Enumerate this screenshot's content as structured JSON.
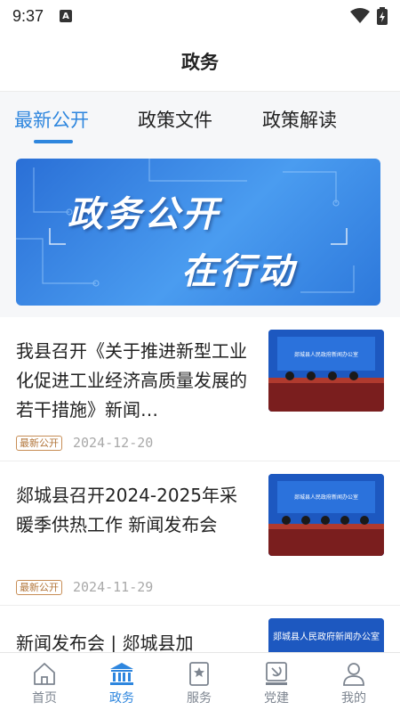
{
  "status": {
    "time": "9:37"
  },
  "header": {
    "title": "政务"
  },
  "tabs": [
    {
      "label": "最新公开",
      "active": true
    },
    {
      "label": "政策文件",
      "active": false
    },
    {
      "label": "政策解读",
      "active": false
    }
  ],
  "banner": {
    "line1": "政务公开",
    "line2": "在行动"
  },
  "news": [
    {
      "title": "我县召开《关于推进新型工业化促进工业经济高质量发展的若干措施》新闻…",
      "tag": "最新公开",
      "date": "2024-12-20",
      "thumb_caption": "郯城县人民政府新闻办公室"
    },
    {
      "title": "郯城县召开2024-2025年采暖季供热工作 新闻发布会",
      "tag": "最新公开",
      "date": "2024-11-29",
      "thumb_caption": "郯城县人民政府新闻办公室"
    },
    {
      "title": "新闻发布会 | 郯城县加",
      "thumb_caption": "郯城县人民政府新闻办公室"
    }
  ],
  "bottom_nav": [
    {
      "label": "首页",
      "icon": "home-icon",
      "active": false
    },
    {
      "label": "政务",
      "icon": "government-building-icon",
      "active": true
    },
    {
      "label": "服务",
      "icon": "service-bookmark-icon",
      "active": false
    },
    {
      "label": "党建",
      "icon": "party-emblem-icon",
      "active": false
    },
    {
      "label": "我的",
      "icon": "user-icon",
      "active": false
    }
  ],
  "colors": {
    "accent": "#2e86de",
    "tag": "#b2753a",
    "inactive": "#7d8590"
  }
}
